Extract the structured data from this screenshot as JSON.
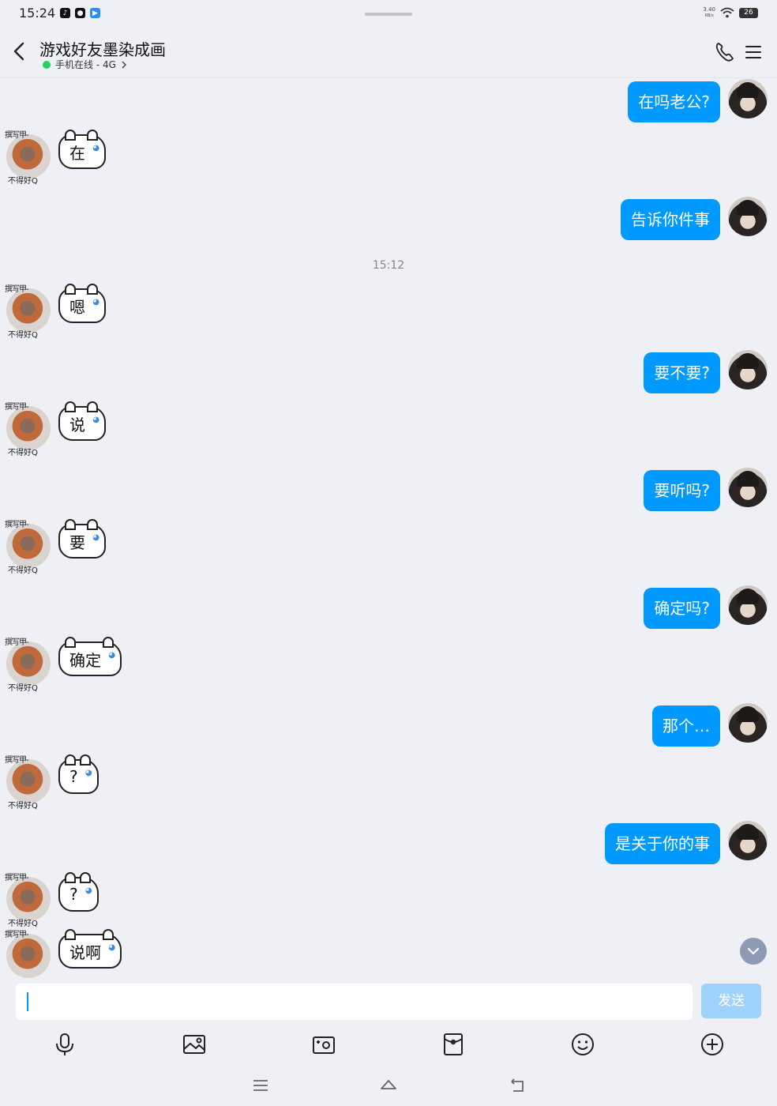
{
  "status_bar": {
    "time": "15:24",
    "apps": [
      "tiktok-icon",
      "wechat-icon",
      "browser-icon"
    ],
    "net_speed_value": "3.40",
    "net_speed_unit": "KB/s",
    "battery": "26"
  },
  "header": {
    "title": "游戏好友墨染成画",
    "subtitle": "手机在线 - 4G",
    "online_color": "#23d160"
  },
  "messages": [
    {
      "side": "right",
      "text": "在吗老公?"
    },
    {
      "side": "left",
      "sticker_text": "在"
    },
    {
      "side": "right",
      "text": "告诉你件事"
    },
    {
      "type": "time",
      "text": "15:12"
    },
    {
      "side": "left",
      "sticker_text": "嗯"
    },
    {
      "side": "right",
      "text": "要不要?"
    },
    {
      "side": "left",
      "sticker_text": "说"
    },
    {
      "side": "right",
      "text": "要听吗?"
    },
    {
      "side": "left",
      "sticker_text": "要"
    },
    {
      "side": "right",
      "text": "确定吗?"
    },
    {
      "side": "left",
      "sticker_text": "确定"
    },
    {
      "side": "right",
      "text": "那个…"
    },
    {
      "side": "left",
      "sticker_text": "?"
    },
    {
      "side": "right",
      "text": "是关于你的事"
    },
    {
      "side": "left",
      "sticker_text": "?"
    },
    {
      "side": "left",
      "sticker_text": "说啊"
    }
  ],
  "avatar_frame": {
    "top": "撰写甲-",
    "bottom": "不得好Q"
  },
  "input": {
    "value": "",
    "send_label": "发送"
  },
  "toolbar": [
    "microphone-icon",
    "image-icon",
    "camera-icon",
    "red-packet-icon",
    "emoji-icon",
    "plus-icon"
  ],
  "colors": {
    "accent": "#0099ff",
    "send_disabled": "#9fd3fb",
    "background": "#eff0f5"
  }
}
